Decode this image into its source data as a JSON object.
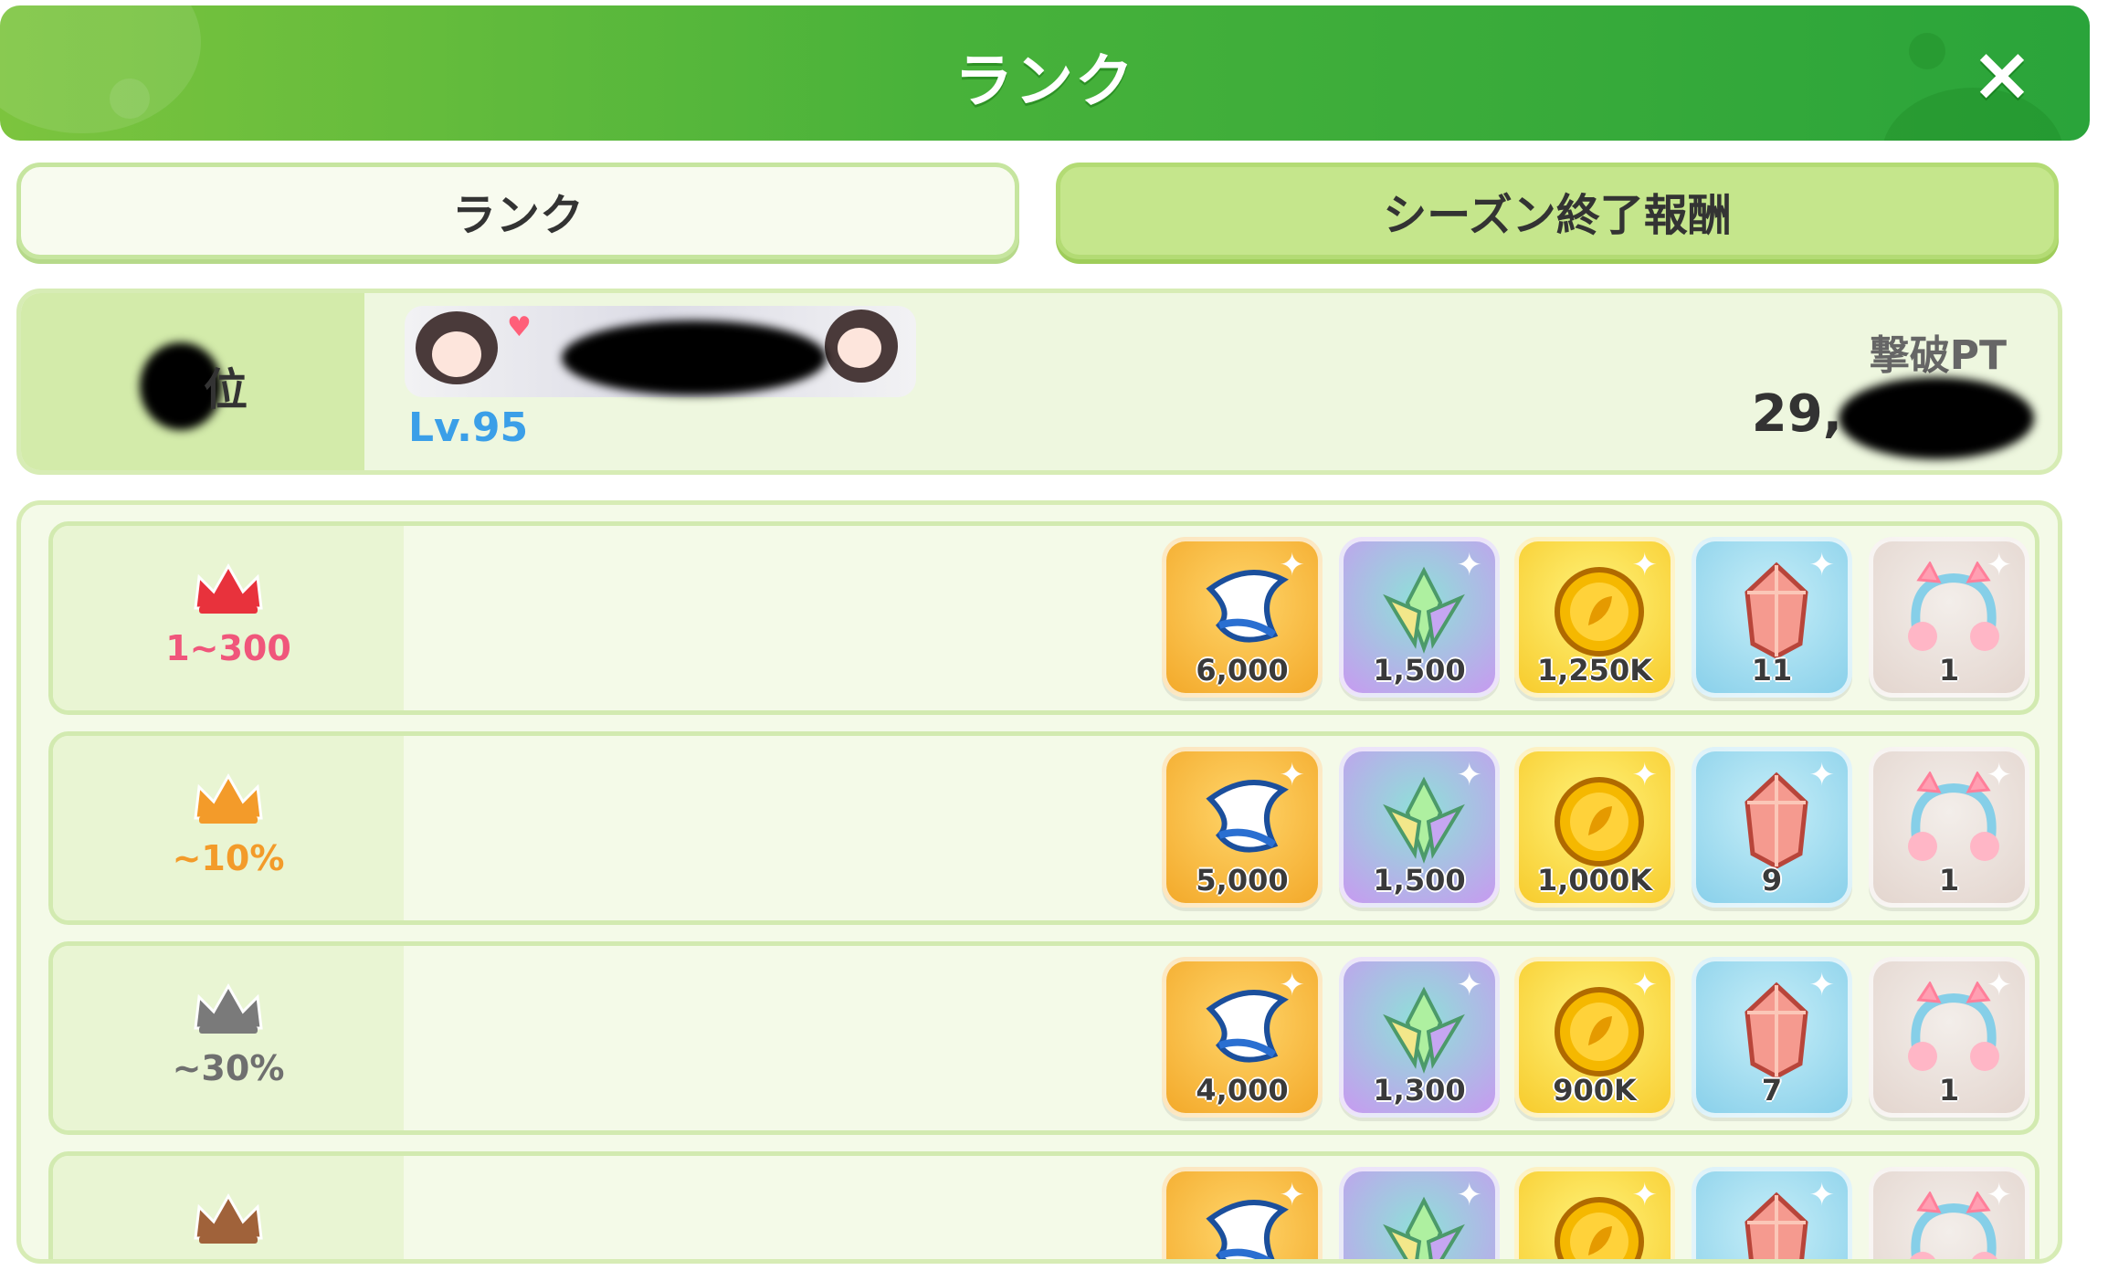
{
  "header": {
    "title": "ランク",
    "close_icon": "×"
  },
  "tabs": [
    {
      "label": "ランク",
      "active": true
    },
    {
      "label": "シーズン終了報酬",
      "active": false
    }
  ],
  "player": {
    "rank_text": "位",
    "level": "Lv.95",
    "points_label": "撃破PT",
    "points_value": "29,"
  },
  "rewards": [
    {
      "tier": "1~300",
      "tier_color": "#f0567b",
      "crown_color": "#e8323c",
      "items": [
        {
          "icon": "feather-icon",
          "qty": "6,000"
        },
        {
          "icon": "leaf-crystal-icon",
          "qty": "1,500"
        },
        {
          "icon": "gold-coin-icon",
          "qty": "1,250K"
        },
        {
          "icon": "pink-gem-icon",
          "qty": "11"
        },
        {
          "icon": "cat-headphones-icon",
          "qty": "1"
        }
      ]
    },
    {
      "tier": "~10%",
      "tier_color": "#f39b2a",
      "crown_color": "#f39b2a",
      "items": [
        {
          "icon": "feather-icon",
          "qty": "5,000"
        },
        {
          "icon": "leaf-crystal-icon",
          "qty": "1,500"
        },
        {
          "icon": "gold-coin-icon",
          "qty": "1,000K"
        },
        {
          "icon": "pink-gem-icon",
          "qty": "9"
        },
        {
          "icon": "cat-headphones-icon",
          "qty": "1"
        }
      ]
    },
    {
      "tier": "~30%",
      "tier_color": "#6f6f6f",
      "crown_color": "#7a7a7a",
      "items": [
        {
          "icon": "feather-icon",
          "qty": "4,000"
        },
        {
          "icon": "leaf-crystal-icon",
          "qty": "1,300"
        },
        {
          "icon": "gold-coin-icon",
          "qty": "900K"
        },
        {
          "icon": "pink-gem-icon",
          "qty": "7"
        },
        {
          "icon": "cat-headphones-icon",
          "qty": "1"
        }
      ]
    },
    {
      "tier": "",
      "tier_color": "#8a5a3a",
      "crown_color": "#a0623a",
      "items": [
        {
          "icon": "feather-icon",
          "qty": ""
        },
        {
          "icon": "leaf-crystal-icon",
          "qty": ""
        },
        {
          "icon": "gold-coin-icon",
          "qty": ""
        },
        {
          "icon": "pink-gem-icon",
          "qty": ""
        },
        {
          "icon": "cat-headphones-icon",
          "qty": ""
        }
      ]
    }
  ]
}
